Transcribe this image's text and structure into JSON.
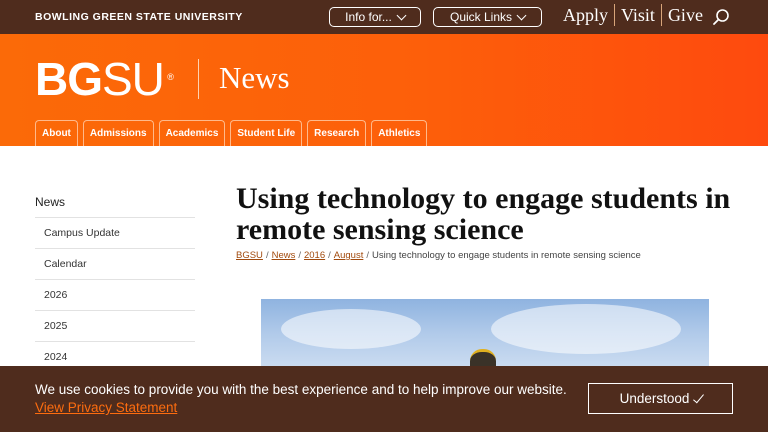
{
  "topbar": {
    "university": "BOWLING GREEN STATE UNIVERSITY",
    "info_for": "Info for...",
    "quick_links": "Quick Links",
    "links": [
      "Apply",
      "Visit",
      "Give"
    ]
  },
  "header": {
    "logo_bold": "BG",
    "logo_light": "SU",
    "logo_reg": "®",
    "site_title": "News",
    "nav": [
      "About",
      "Admissions",
      "Academics",
      "Student Life",
      "Research",
      "Athletics"
    ]
  },
  "sidebar": {
    "heading": "News",
    "items": [
      "Campus Update",
      "Calendar",
      "2026",
      "2025",
      "2024"
    ]
  },
  "article": {
    "title": "Using technology to engage students in remote sensing science",
    "breadcrumb": [
      "BGSU",
      "News",
      "2016",
      "August"
    ],
    "breadcrumb_current": "Using technology to engage students in remote sensing science"
  },
  "cookie": {
    "message": "We use cookies to provide you with the best experience and to help improve our website.",
    "link": "View Privacy Statement",
    "button": "Understood"
  },
  "colors": {
    "brown": "#4f2c1d",
    "orange": "#fd5f0a",
    "link_orange": "#fd6c0f"
  }
}
